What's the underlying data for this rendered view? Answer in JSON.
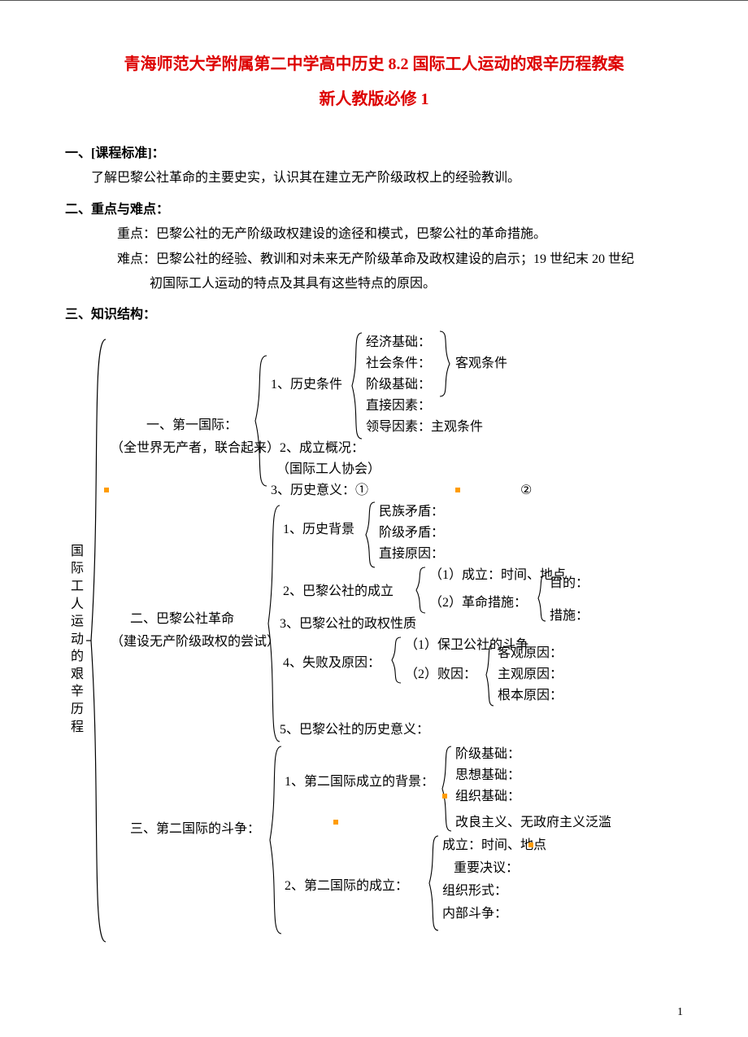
{
  "title_line1": "青海师范大学附属第二中学高中历史 8.2 国际工人运动的艰辛历程教案",
  "title_line2": "新人教版必修 1",
  "sec1_head": "一、[课程标准]：",
  "sec1_body": "了解巴黎公社革命的主要史实，认识其在建立无产阶级政权上的经验教训。",
  "sec2_head": "二、重点与难点：",
  "sec2_l1": "重点：巴黎公社的无产阶级政权建设的途径和模式，巴黎公社的革命措施。",
  "sec2_l2": "难点：巴黎公社的经验、教训和对未来无产阶级革命及政权建设的启示；19 世纪末 20 世纪",
  "sec2_l3": "初国际工人运动的特点及其具有这些特点的原因。",
  "sec3_head": "三、知识结构：",
  "vlabel": "国际工人运动的艰辛历程",
  "n1_title": "一、第一国际：",
  "n1_sub": "（全世界无产者，联合起来）",
  "n1_1": "1、历史条件",
  "n1_1a": "经济基础：",
  "n1_1b": "社会条件：",
  "n1_1c": "阶级基础：",
  "n1_1d": "直接因素：",
  "n1_1e": "领导因素：主观条件",
  "n1_1r": "客观条件",
  "n1_2": "2、成立概况：",
  "n1_2a": "（国际工人协会）",
  "n1_3": "3、历史意义：①",
  "n1_3b": "②",
  "n2_title1": "二、巴黎公社革命",
  "n2_title2": "（建设无产阶级政权的尝试）",
  "n2_1": "1、历史背景",
  "n2_1a": "民族矛盾：",
  "n2_1b": "阶级矛盾：",
  "n2_1c": "直接原因：",
  "n2_2": "2、巴黎公社的成立",
  "n2_2a": "（1）成立：时间、地点",
  "n2_2b": "（2）革命措施：",
  "n2_2b1": "目的：",
  "n2_2b2": "措施：",
  "n2_3": "3、巴黎公社的政权性质",
  "n2_4": "4、失败及原因：",
  "n2_4a": "（1）保卫公社的斗争",
  "n2_4b": "（2）败因：",
  "n2_4b1": "客观原因：",
  "n2_4b2": "主观原因：",
  "n2_4b3": "根本原因：",
  "n2_5": "5、巴黎公社的历史意义：",
  "n3_title": "三、第二国际的斗争：",
  "n3_1": "1、第二国际成立的背景：",
  "n3_1a": "阶级基础：",
  "n3_1b": "思想基础：",
  "n3_1c": "组织基础：",
  "n3_1d": "改良主义、无政府主义泛滥",
  "n3_2": "2、第二国际的成立：",
  "n3_2a": "成立：时间、地点",
  "n3_2b": "重要决议：",
  "n3_2c": "组织形式：",
  "n3_2d": "内部斗争：",
  "page_number": "1"
}
